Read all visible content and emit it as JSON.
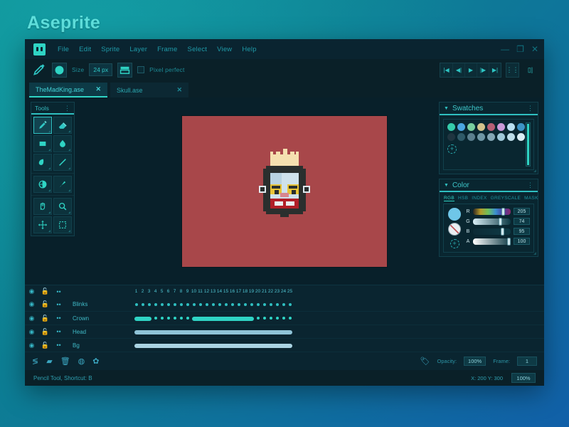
{
  "brand": {
    "name": "Aseprite"
  },
  "theme": {
    "accent": "#2fd4c4",
    "panel_bg": "#092630",
    "window_bg": "#0b2430",
    "canvas_bg": "#a8474a",
    "desktop_gradient_from": "#0e8f96",
    "desktop_gradient_to": "#1160a8"
  },
  "menubar": {
    "app_icon": "aseprite-logo-icon",
    "items": [
      {
        "label": "File"
      },
      {
        "label": "Edit"
      },
      {
        "label": "Sprite"
      },
      {
        "label": "Layer"
      },
      {
        "label": "Frame"
      },
      {
        "label": "Select"
      },
      {
        "label": "View"
      },
      {
        "label": "Help"
      }
    ],
    "window_controls": [
      {
        "name": "minimize-button",
        "glyph": "—"
      },
      {
        "name": "maximize-button",
        "glyph": "❐"
      },
      {
        "name": "close-button",
        "glyph": "✕"
      }
    ]
  },
  "options_bar": {
    "tool_icon": "pencil-icon",
    "brush_icon": "circle-brush-icon",
    "size_label": "Size",
    "size_value": "24 px",
    "ink_icon": "ink-type-icon",
    "pixel_perfect_label": "Pixel perfect",
    "pixel_perfect_checked": false,
    "playback": [
      {
        "name": "go-to-first-frame-button",
        "glyph": "|◀"
      },
      {
        "name": "previous-frame-button",
        "glyph": "◀|"
      },
      {
        "name": "play-animation-button",
        "glyph": "▶"
      },
      {
        "name": "next-frame-button",
        "glyph": "|▶"
      },
      {
        "name": "go-to-last-frame-button",
        "glyph": "▶|"
      }
    ],
    "onion_skin_button": "onion-skin-icon",
    "layout_button": "timeline-layout-icon"
  },
  "tabs": [
    {
      "label": "TheMadKing.ase",
      "active": true,
      "close": "✕"
    },
    {
      "label": "Skull.ase",
      "active": false,
      "close": "✕"
    }
  ],
  "tools_panel": {
    "title": "Tools",
    "menu_icon": "kebab-menu-icon",
    "groups": [
      [
        {
          "name": "pencil-tool",
          "icon": "pencil-icon",
          "selected": true
        },
        {
          "name": "eraser-tool",
          "icon": "eraser-icon",
          "selected": false
        },
        {
          "name": "rectangle-tool",
          "icon": "rectangle-icon",
          "selected": false
        },
        {
          "name": "paint-bucket-tool",
          "icon": "bucket-fill-icon",
          "selected": false
        },
        {
          "name": "curve-tool",
          "icon": "curve-icon",
          "selected": false
        },
        {
          "name": "line-tool",
          "icon": "line-icon",
          "selected": false
        }
      ],
      [
        {
          "name": "gradient-tool",
          "icon": "gradient-icon",
          "selected": false
        },
        {
          "name": "blur-tool",
          "icon": "blur-icon",
          "selected": false
        }
      ],
      [
        {
          "name": "hand-tool",
          "icon": "hand-icon",
          "selected": false
        },
        {
          "name": "zoom-tool",
          "icon": "magnifier-icon",
          "selected": false
        },
        {
          "name": "move-tool",
          "icon": "move-arrows-icon",
          "selected": false
        },
        {
          "name": "marquee-select-tool",
          "icon": "marquee-select-icon",
          "selected": false
        }
      ]
    ]
  },
  "canvas": {
    "background_color": "#a8474a",
    "sprite_name": "mad-king-sprite",
    "sprite_palette": {
      "outline": "#2a2f2e",
      "skin": "#cfe2ec",
      "skin_shade": "#b9d3e2",
      "eye_patch": "#e8c438",
      "eye_dark": "#2a2f2e",
      "nose": "#d8868f",
      "mouth": "#b01f28",
      "teeth": "#e8eef2",
      "crown": "#f5e0b0",
      "ear": "#dfe8ee"
    }
  },
  "swatches_panel": {
    "title": "Swatches",
    "menu_icon": "kebab-menu-icon",
    "rows": [
      [
        "#35cbaa",
        "#4ba6e0",
        "#79cf9e",
        "#d4c38c",
        "#b75f75",
        "#cb9ad8",
        "#b9dff0",
        "#3d93c4"
      ],
      [
        "#1f3540",
        "#2f5a68",
        "#5b7f8e",
        "#6f97a5",
        "#84a7b5",
        "#9fc8d8",
        "#bcdce8",
        "#dceef5"
      ]
    ],
    "add_button": "add-swatch-button"
  },
  "color_panel": {
    "title": "Color",
    "menu_icon": "kebab-menu-icon",
    "tabs": [
      {
        "label": "RGB",
        "active": true
      },
      {
        "label": "HSB",
        "active": false
      },
      {
        "label": "INDEX",
        "active": false
      },
      {
        "label": "GREYSCALE",
        "active": false
      },
      {
        "label": "MASK",
        "active": false
      }
    ],
    "foreground_color": "#6fc6e8",
    "background_color": "#e9eef2",
    "add_button": "add-color-button",
    "sliders": [
      {
        "label": "R",
        "value": "205",
        "percent": 80,
        "gradient": "linear-gradient(90deg,#2a2522,#b59a2a,#6fc05a,#3a8fd0,#4a3aa0,#8b2a6a)"
      },
      {
        "label": "G",
        "value": "74",
        "percent": 73,
        "gradient": "linear-gradient(90deg,#d8eef6,#0d3a45)"
      },
      {
        "label": "B",
        "value": "95",
        "percent": 78,
        "gradient": "linear-gradient(90deg,#0d2b36,#0d3a45)"
      },
      {
        "label": "A",
        "value": "100",
        "percent": 96,
        "gradient": "linear-gradient(90deg,#ffffff,#0d3a45)"
      }
    ]
  },
  "timeline": {
    "frame_count": 25,
    "frame_numbers": [
      1,
      2,
      3,
      4,
      5,
      6,
      7,
      8,
      9,
      10,
      11,
      12,
      13,
      14,
      15,
      16,
      17,
      18,
      19,
      20,
      21,
      22,
      23,
      24,
      25
    ],
    "header_controls": {
      "visibility": "eye-icon",
      "lock": "unlock-icon",
      "continuous": "continuous-icon"
    },
    "layers": [
      {
        "name": "Blinks",
        "visible": true,
        "locked": false,
        "color": "#2fbfc0",
        "cells": [
          {
            "type": "dot",
            "start": 1,
            "end": 1
          },
          {
            "type": "dot",
            "start": 2,
            "end": 2
          },
          {
            "type": "dot",
            "start": 3,
            "end": 3
          },
          {
            "type": "dot",
            "start": 4,
            "end": 4
          },
          {
            "type": "dot",
            "start": 5,
            "end": 5
          },
          {
            "type": "dot",
            "start": 6,
            "end": 6
          },
          {
            "type": "dot",
            "start": 7,
            "end": 7
          },
          {
            "type": "dot",
            "start": 8,
            "end": 8
          },
          {
            "type": "dot",
            "start": 9,
            "end": 9
          },
          {
            "type": "dot",
            "start": 10,
            "end": 10
          },
          {
            "type": "dot",
            "start": 11,
            "end": 11
          },
          {
            "type": "dot",
            "start": 12,
            "end": 12
          },
          {
            "type": "dot",
            "start": 13,
            "end": 13
          },
          {
            "type": "dot",
            "start": 14,
            "end": 14
          },
          {
            "type": "dot",
            "start": 15,
            "end": 15
          },
          {
            "type": "dot",
            "start": 16,
            "end": 16
          },
          {
            "type": "dot",
            "start": 17,
            "end": 17
          },
          {
            "type": "dot",
            "start": 18,
            "end": 18
          },
          {
            "type": "dot",
            "start": 19,
            "end": 19
          },
          {
            "type": "dot",
            "start": 20,
            "end": 20
          },
          {
            "type": "dot",
            "start": 21,
            "end": 21
          },
          {
            "type": "dot",
            "start": 22,
            "end": 22
          },
          {
            "type": "dot",
            "start": 23,
            "end": 23
          },
          {
            "type": "dot",
            "start": 24,
            "end": 24
          },
          {
            "type": "dot",
            "start": 25,
            "end": 25
          }
        ]
      },
      {
        "name": "Crown",
        "visible": true,
        "locked": false,
        "color": "#2fd4c4",
        "cells": [
          {
            "type": "span",
            "start": 1,
            "end": 3
          },
          {
            "type": "dot",
            "start": 4,
            "end": 4
          },
          {
            "type": "dot",
            "start": 5,
            "end": 5
          },
          {
            "type": "dot",
            "start": 6,
            "end": 6
          },
          {
            "type": "dot",
            "start": 7,
            "end": 7
          },
          {
            "type": "dot",
            "start": 8,
            "end": 8
          },
          {
            "type": "dot",
            "start": 9,
            "end": 9
          },
          {
            "type": "span",
            "start": 10,
            "end": 19
          },
          {
            "type": "dot",
            "start": 20,
            "end": 20
          },
          {
            "type": "dot",
            "start": 21,
            "end": 21
          },
          {
            "type": "dot",
            "start": 22,
            "end": 22
          },
          {
            "type": "dot",
            "start": 23,
            "end": 23
          },
          {
            "type": "dot",
            "start": 24,
            "end": 24
          },
          {
            "type": "dot",
            "start": 25,
            "end": 25
          }
        ]
      },
      {
        "name": "Head",
        "visible": true,
        "locked": false,
        "color": "#8fc4d8",
        "cells": [
          {
            "type": "span",
            "start": 1,
            "end": 25
          }
        ]
      },
      {
        "name": "Bg",
        "visible": true,
        "locked": false,
        "color": "#a9d3e2",
        "cells": [
          {
            "type": "span",
            "start": 1,
            "end": 25
          }
        ]
      }
    ],
    "bottom_bar": {
      "icons": [
        {
          "name": "new-layer-button",
          "glyph": "≶"
        },
        {
          "name": "new-group-button",
          "glyph": "▰"
        },
        {
          "name": "delete-layer-button",
          "glyph": "🗑"
        },
        {
          "name": "onion-skin-button",
          "glyph": "◍"
        },
        {
          "name": "timeline-settings-button",
          "glyph": "✿"
        }
      ],
      "tag_icon": "tag-icon",
      "opacity_label": "Opacity:",
      "opacity_value": "100%",
      "frame_label": "Frame:",
      "frame_value": "1"
    }
  },
  "statusbar": {
    "message": "Pencil Tool, Shortcut: B",
    "coordinates": "X: 200  Y: 300",
    "zoom": "100%"
  }
}
